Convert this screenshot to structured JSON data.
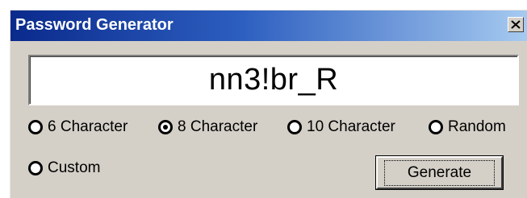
{
  "window": {
    "title": "Password Generator",
    "close_icon": "close-icon"
  },
  "display": {
    "password": "nn3!br_R"
  },
  "options": [
    {
      "label": "6 Character",
      "selected": false
    },
    {
      "label": "8 Character",
      "selected": true
    },
    {
      "label": "10 Character",
      "selected": false
    },
    {
      "label": "Random",
      "selected": false
    },
    {
      "label": "Custom",
      "selected": false
    }
  ],
  "actions": {
    "generate_label": "Generate"
  },
  "colors": {
    "titlebar_start": "#0a2a8c",
    "titlebar_end": "#a6caf0",
    "face": "#d4d0c8"
  }
}
